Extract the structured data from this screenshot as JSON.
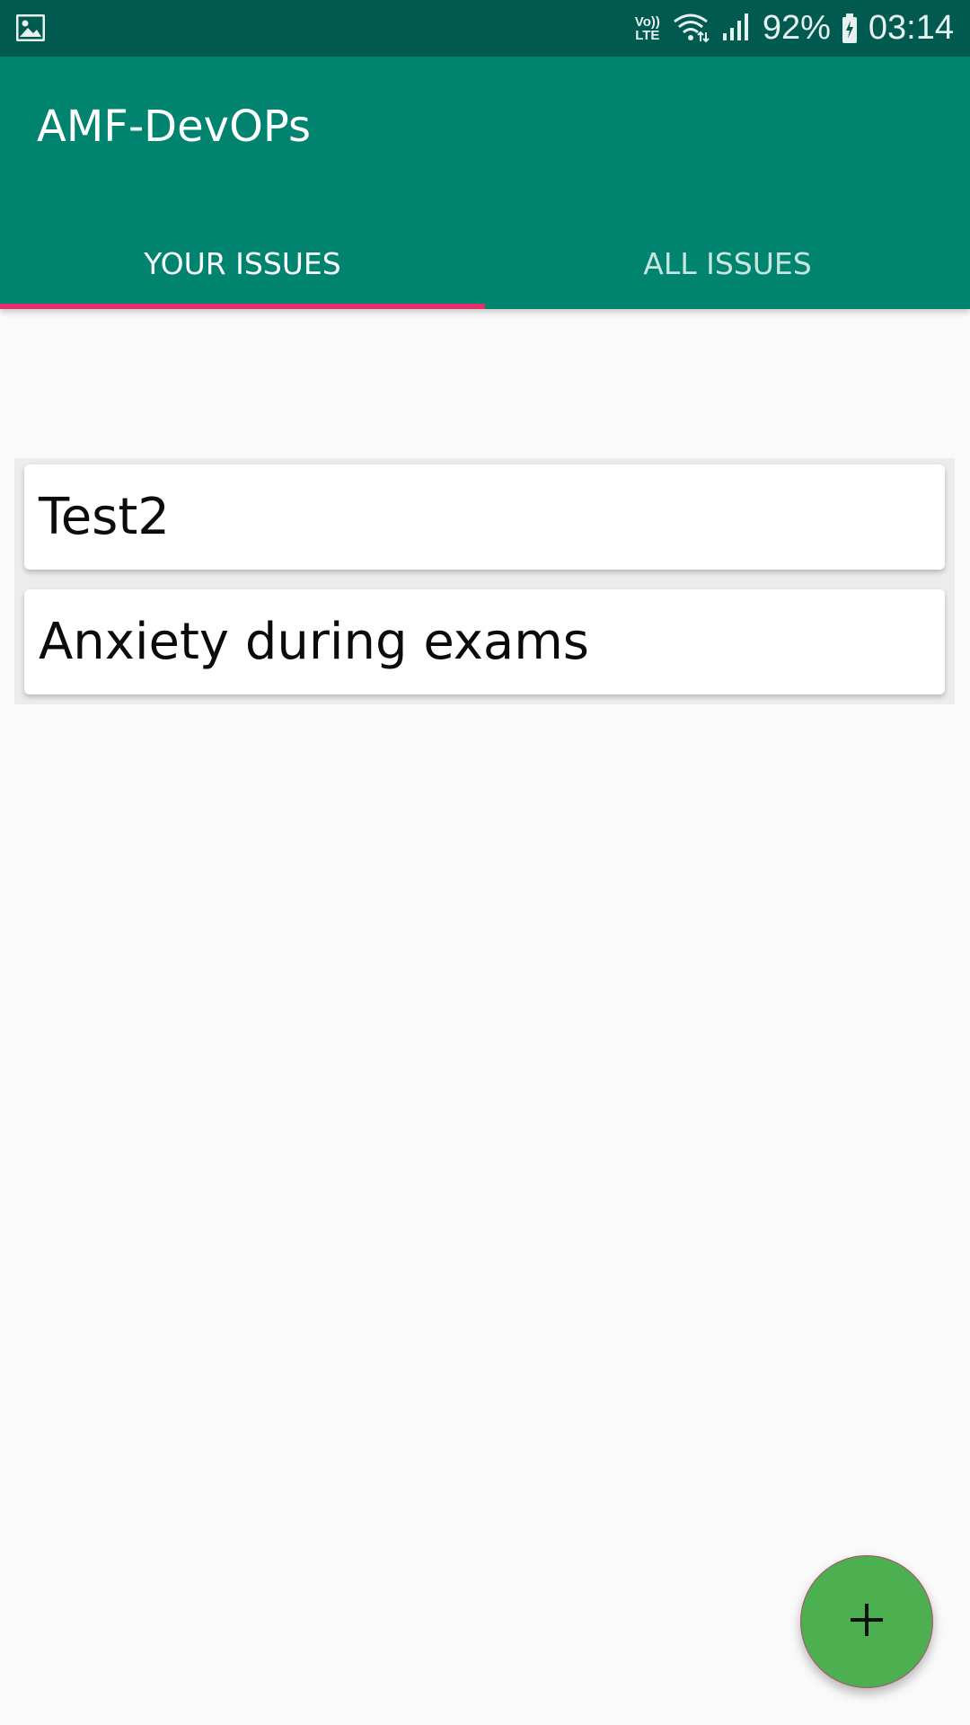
{
  "status_bar": {
    "left_icon": "image-icon",
    "volte_line1": "Vo))",
    "volte_line2": "LTE",
    "wifi_icon": "wifi-icon",
    "signal_icon": "signal-icon",
    "battery_percent": "92%",
    "battery_icon": "battery-charging-icon",
    "time": "03:14"
  },
  "app_bar": {
    "title": "AMF-DevOPs",
    "tabs": [
      {
        "label": "YOUR ISSUES",
        "selected": true
      },
      {
        "label": "ALL ISSUES",
        "selected": false
      }
    ],
    "accent_color": "#e1306c",
    "background_color": "#00846f"
  },
  "issues": [
    {
      "title": "Test2"
    },
    {
      "title": "Anxiety during exams"
    }
  ],
  "fab": {
    "icon": "plus-icon",
    "color": "#4caf50"
  }
}
